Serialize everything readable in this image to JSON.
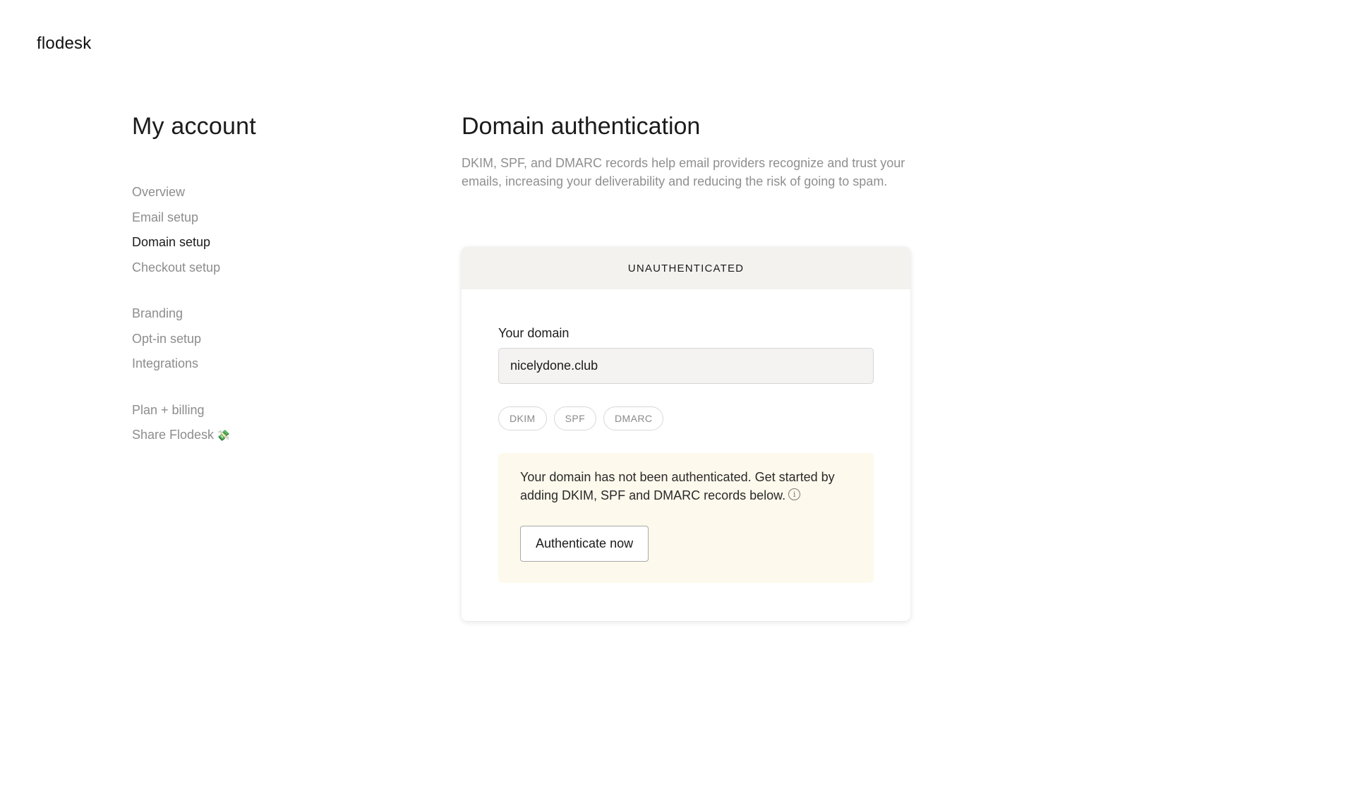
{
  "brand": {
    "logo_text": "flodesk"
  },
  "sidebar": {
    "title": "My account",
    "groups": [
      {
        "items": [
          {
            "label": "Overview",
            "active": false
          },
          {
            "label": "Email setup",
            "active": false
          },
          {
            "label": "Domain setup",
            "active": true
          },
          {
            "label": "Checkout setup",
            "active": false
          }
        ]
      },
      {
        "items": [
          {
            "label": "Branding",
            "active": false
          },
          {
            "label": "Opt-in setup",
            "active": false
          },
          {
            "label": "Integrations",
            "active": false
          }
        ]
      },
      {
        "items": [
          {
            "label": "Plan + billing",
            "active": false
          },
          {
            "label": "Share Flodesk",
            "emoji": "💸",
            "active": false
          }
        ]
      }
    ]
  },
  "main": {
    "title": "Domain authentication",
    "description": "DKIM, SPF, and DMARC records help email providers recognize and trust your emails, increasing your deliverability and reducing the risk of going to spam.",
    "card": {
      "status": "UNAUTHENTICATED",
      "domain_label": "Your domain",
      "domain_value": "nicelydone.club",
      "pills": [
        "DKIM",
        "SPF",
        "DMARC"
      ],
      "notice_text": "Your domain has not been authenticated. Get started by adding DKIM, SPF and DMARC records below.",
      "info_icon": "info-circle-icon",
      "button_label": "Authenticate now"
    }
  },
  "colors": {
    "text_primary": "#1b1b1b",
    "text_muted": "#8d8d8d",
    "card_header_bg": "#f3f2ef",
    "notice_bg": "#fdf9ec"
  }
}
